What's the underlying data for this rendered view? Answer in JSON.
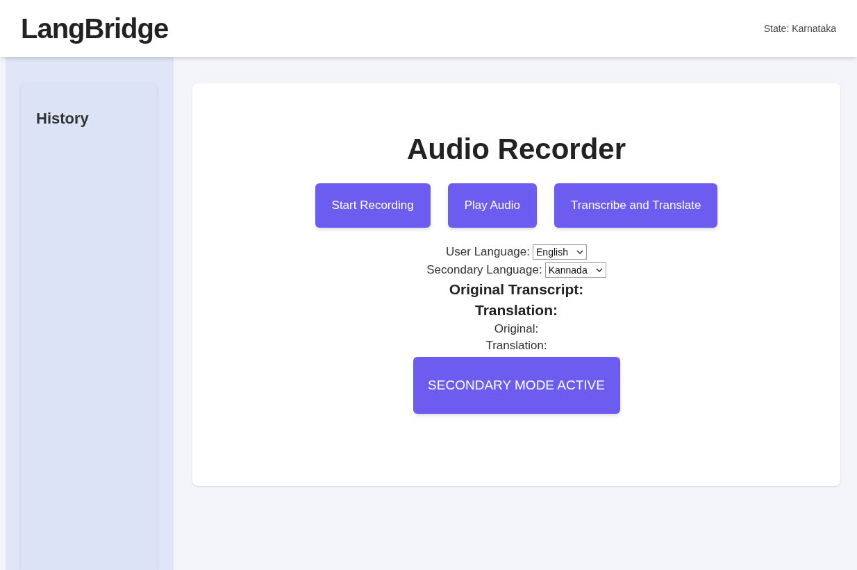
{
  "header": {
    "title": "LangBridge",
    "state": "State: Karnataka"
  },
  "sidebar": {
    "title": "History"
  },
  "recorder": {
    "title": "Audio Recorder",
    "buttons": [
      "Start Recording",
      "Play Audio",
      "Transcribe and Translate"
    ],
    "selects": [
      {
        "label": "User Language:",
        "value": "English"
      },
      {
        "label": "Secondary Language:",
        "value": "Kannada"
      }
    ],
    "headings": [
      "Original Transcript:",
      "Translation:"
    ],
    "lines": [
      "Original:",
      "Translation:"
    ],
    "mode_button": {
      "label": "SECONDARY MODE ACTIVE",
      "active": true
    }
  }
}
